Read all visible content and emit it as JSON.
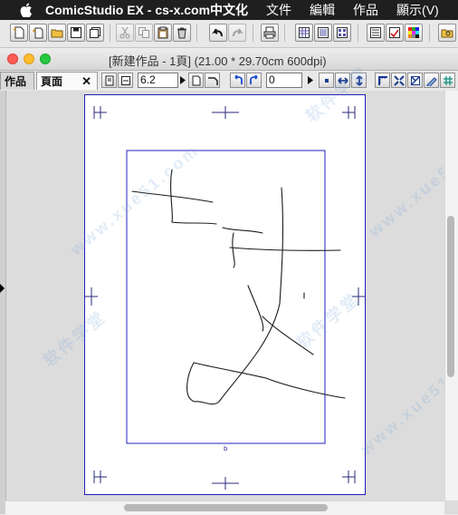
{
  "menubar": {
    "app_name": "ComicStudio EX - cs-x.com中文化",
    "items": [
      "文件",
      "編輯",
      "作品",
      "顯示(V)"
    ]
  },
  "window": {
    "title": "[新建作品 - 1頁] (21.00 * 29.70cm 600dpi)"
  },
  "tabs": [
    {
      "label": "作品",
      "active": false
    },
    {
      "label": "頁面",
      "active": true
    }
  ],
  "subtoolbar": {
    "value_1": "6.2",
    "value_2": "0"
  },
  "watermarks": [
    "软件学堂",
    "www.xue51.com"
  ],
  "colors": {
    "page_border": "#2020c0",
    "canvas_bg": "#dcdcdc",
    "menubar_bg": "#1f1f1f"
  }
}
